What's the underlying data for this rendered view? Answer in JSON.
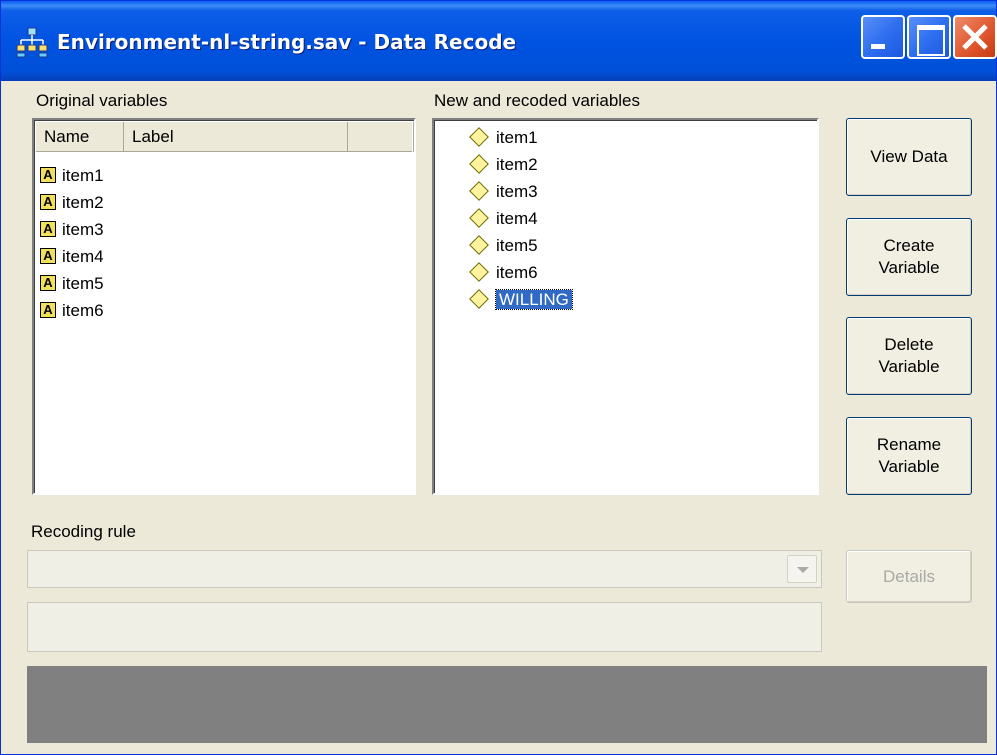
{
  "window": {
    "title": "Environment-nl-string.sav - Data Recode"
  },
  "original": {
    "label": "Original variables",
    "columns": [
      "Name",
      "Label"
    ],
    "type_icon_glyph": "A",
    "items": [
      "item1",
      "item2",
      "item3",
      "item4",
      "item5",
      "item6"
    ]
  },
  "recoded": {
    "label": "New and recoded variables",
    "items": [
      "item1",
      "item2",
      "item3",
      "item4",
      "item5",
      "item6",
      "WILLING"
    ],
    "selected_item": "WILLING"
  },
  "buttons": {
    "view_data": "View Data",
    "create_variable_1": "Create",
    "create_variable_2": "Variable",
    "delete_variable_1": "Delete",
    "delete_variable_2": "Variable",
    "rename_variable_1": "Rename",
    "rename_variable_2": "Variable",
    "details": "Details"
  },
  "recoding": {
    "label": "Recoding rule",
    "selected_value": ""
  },
  "colors": {
    "titlebar": "#0053e1",
    "selection": "#316ac5",
    "face": "#ece9d8",
    "statusbar": "#808080"
  }
}
